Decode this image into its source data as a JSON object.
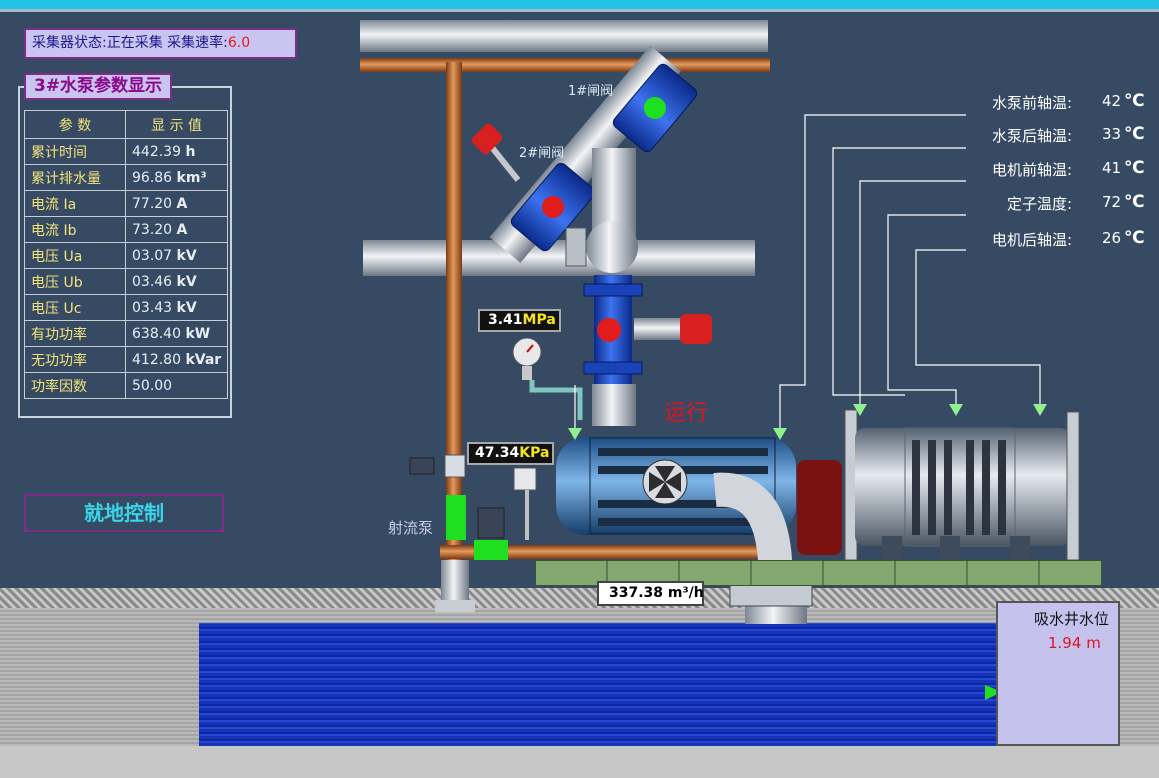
{
  "collector": {
    "status_label": "采集器状态:",
    "status_value": "正在采集",
    "rate_label": "采集速率:",
    "rate_value": "6.0"
  },
  "param_panel": {
    "title": "3#水泵参数显示",
    "header_name": "参   数",
    "header_value": "显 示 值",
    "rows": [
      {
        "name": "累计时间",
        "value": "442.39",
        "unit": "h"
      },
      {
        "name": "累计排水量",
        "value": "96.86",
        "unit": "km³"
      },
      {
        "name": "电流 Ia",
        "value": "77.20",
        "unit": "A"
      },
      {
        "name": "电流 Ib",
        "value": "73.20",
        "unit": "A"
      },
      {
        "name": "电压 Ua",
        "value": "03.07",
        "unit": "kV"
      },
      {
        "name": "电压 Ub",
        "value": "03.46",
        "unit": "kV"
      },
      {
        "name": "电压 Uc",
        "value": "03.43",
        "unit": "kV"
      },
      {
        "name": "有功功率",
        "value": "638.40",
        "unit": "kW"
      },
      {
        "name": "无功功率",
        "value": "412.80",
        "unit": "kVar"
      },
      {
        "name": "功率因数",
        "value": "50.00",
        "unit": ""
      }
    ]
  },
  "local_control": {
    "label": "就地控制"
  },
  "valves": {
    "valve1": "1#闸阀",
    "valve2": "2#闸阀"
  },
  "jet_pump": {
    "label": "射流泵"
  },
  "pump_status": {
    "label": "运行",
    "color": "#e0141e"
  },
  "temperatures": [
    {
      "label": "水泵前轴温:",
      "value": "42",
      "unit": "℃"
    },
    {
      "label": "水泵后轴温:",
      "value": "33",
      "unit": "℃"
    },
    {
      "label": "电机前轴温:",
      "value": "41",
      "unit": "℃"
    },
    {
      "label": "定子温度:",
      "value": "72",
      "unit": "℃"
    },
    {
      "label": "电机后轴温:",
      "value": "26",
      "unit": "℃"
    }
  ],
  "readouts": {
    "outlet_pressure": {
      "value": "3.41",
      "unit": "MPa"
    },
    "inlet_pressure": {
      "value": "47.34",
      "unit": "KPa"
    },
    "flow": {
      "value": "337.38",
      "unit": "m³/h"
    }
  },
  "well": {
    "title": "吸水井水位",
    "value": "1.94",
    "unit": "m"
  },
  "colors": {
    "accent_title": "#8a0a8a",
    "label_yellow": "#f3e27a",
    "valve_red": "#e01c1c",
    "valve_green": "#1ee01e",
    "pipe_copper": "#b5602a",
    "background": "#364b63"
  }
}
